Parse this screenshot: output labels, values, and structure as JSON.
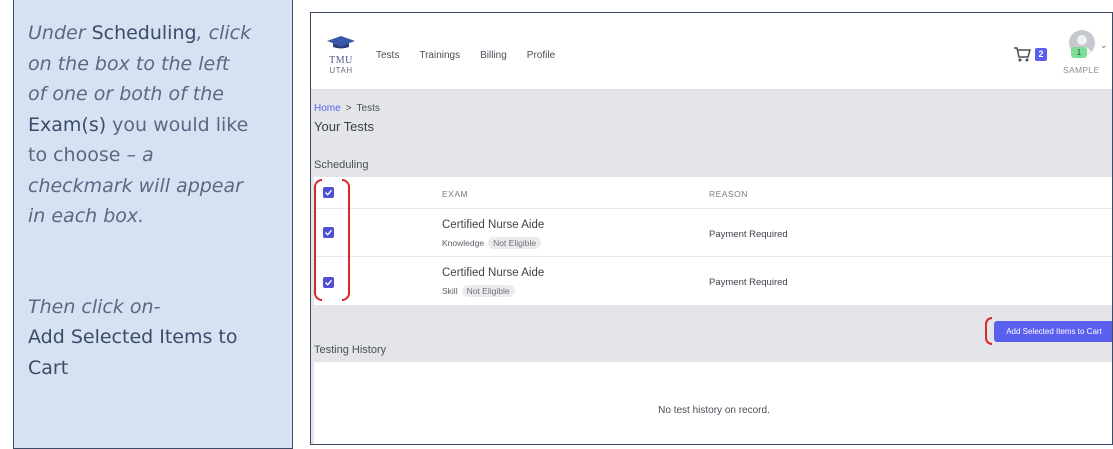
{
  "instructions": {
    "line1_a": "Under ",
    "line1_b": "Scheduling",
    "line1_c": ", click",
    "line2": "on the box to the left",
    "line3": "of one or both of the",
    "line4_a": "Exam(s)",
    "line4_b": " you would like",
    "line5_a": "to choose – ",
    "line5_b": "a",
    "line6": "checkmark will appear",
    "line7": "in each box.",
    "line8": "Then click on-",
    "line9": "Add Selected Items to",
    "line10": "Cart"
  },
  "app": {
    "logo_top": "TMU",
    "logo_bottom": "UTAH",
    "nav": [
      "Tests",
      "Trainings",
      "Billing",
      "Profile"
    ],
    "cart_count": "2",
    "avatar_badge": "1",
    "user_label": "SAMPLE",
    "breadcrumb": {
      "home": "Home",
      "current": "Tests"
    },
    "page_title": "Your Tests",
    "scheduling_label": "Scheduling",
    "table": {
      "headers": {
        "exam": "EXAM",
        "reason": "REASON"
      },
      "rows": [
        {
          "name": "Certified Nurse Aide",
          "type": "Knowledge",
          "status": "Not Eligible",
          "reason": "Payment Required",
          "checked": true
        },
        {
          "name": "Certified Nurse Aide",
          "type": "Skill",
          "status": "Not Eligible",
          "reason": "Payment Required",
          "checked": true
        }
      ]
    },
    "add_button": "Add Selected Items to Cart",
    "history_label": "Testing History",
    "history_empty": "No test history on record.",
    "colors": {
      "accent": "#5b5ff0",
      "highlight": "#d8292a",
      "panel": "#d6e2f1"
    }
  }
}
